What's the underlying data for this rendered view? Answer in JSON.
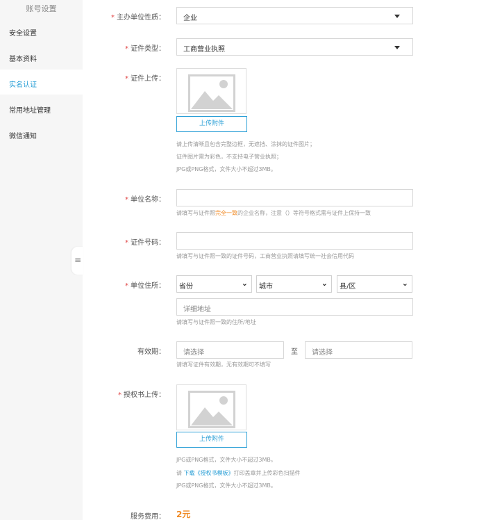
{
  "sidebar": {
    "title": "账号设置",
    "items": [
      {
        "label": "安全设置"
      },
      {
        "label": "基本资料"
      },
      {
        "label": "实名认证"
      },
      {
        "label": "常用地址管理"
      },
      {
        "label": "微信通知"
      }
    ],
    "active_index": 2,
    "collapse_icon": "≡"
  },
  "form": {
    "required_mark": "*",
    "org_type": {
      "label": "主办单位性质：",
      "value": "企业"
    },
    "cert_type": {
      "label": "证件类型：",
      "value": "工商营业执照"
    },
    "cert_upload": {
      "label": "证件上传：",
      "button": "上传附件",
      "hints": [
        "请上传清晰且包含完整边框，无遮挡、涂抹的证件图片；",
        "证件图片需为彩色，不支持电子营业执照；",
        "JPG或PNG格式，文件大小不超过3MB。"
      ]
    },
    "org_name": {
      "label": "单位名称：",
      "value": "",
      "hint_prefix": "请填写与证件照",
      "hint_highlight": "完全一致",
      "hint_suffix": "的企业名称，注意（）等符号格式需与证件上保持一致"
    },
    "cert_number": {
      "label": "证件号码：",
      "value": "",
      "hint": "请填写与证件照一致的证件号码，工商营业执照请填写统一社会信用代码"
    },
    "address": {
      "label": "单位住所：",
      "province": "省份",
      "city": "城市",
      "district": "县/区",
      "chevron": "⌄",
      "detail_placeholder": "详细地址",
      "hint": "请填写与证件照一致的住所/地址"
    },
    "validity": {
      "label": "有效期：",
      "start_placeholder": "请选择",
      "sep": "至",
      "end_placeholder": "请选择",
      "hint": "请填写证件有效期，无有效期可不填写"
    },
    "auth_upload": {
      "label": "授权书上传：",
      "button": "上传附件",
      "hint1": "JPG或PNG格式，文件大小不超过3MB。",
      "hint2_prefix": "请 ",
      "hint2_link": "下载《授权书模板》",
      "hint2_suffix": "打印盖章并上传彩色扫描件",
      "hint3": "JPG或PNG格式，文件大小不超过3MB。"
    },
    "fee": {
      "label": "服务费用：",
      "value": "2元"
    }
  },
  "colors": {
    "accent": "#2a9fd6",
    "required": "#e04545",
    "highlight": "#f08a24",
    "sidebar_bg": "#f6f6f6"
  }
}
